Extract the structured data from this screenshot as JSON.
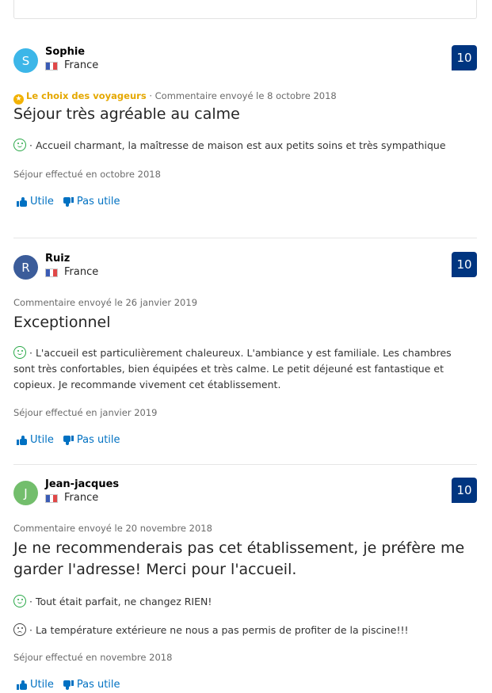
{
  "colors": {
    "score_bg": "#003580",
    "link": "#0071c2",
    "traveller_choice": "#e5a800",
    "positive": "#29a847"
  },
  "reviews": [
    {
      "avatar_letter": "S",
      "avatar_color": "#3cb6e8",
      "name": "Sophie",
      "country": "France",
      "score": "10",
      "badge": "Le choix des voyageurs",
      "badge_separator": "·",
      "posted": "Commentaire envoyé le 8 octobre 2018",
      "title": "Séjour très agréable au calme",
      "positive": "· Accueil charmant, la maîtresse de maison est aux petits soins et très sympathique",
      "stay": "Séjour effectué en octobre 2018",
      "helpful": "Utile",
      "not_helpful": "Pas utile"
    },
    {
      "avatar_letter": "R",
      "avatar_color": "#3b5c9a",
      "name": "Ruiz",
      "country": "France",
      "score": "10",
      "posted": "Commentaire envoyé le 26 janvier 2019",
      "title": "Exceptionnel",
      "positive": "· L'accueil est particulièrement chaleureux. L'ambiance y est familiale. Les chambres sont très confortables, bien équipées et très calme. Le petit déjeuné est fantastique et copieux. Je recommande vivement cet établissement.",
      "stay": "Séjour effectué en janvier 2019",
      "helpful": "Utile",
      "not_helpful": "Pas utile"
    },
    {
      "avatar_letter": "J",
      "avatar_color": "#73be6c",
      "name": "Jean-jacques",
      "country": "France",
      "score": "10",
      "posted": "Commentaire envoyé le 20 novembre 2018",
      "title": "Je ne recommenderais pas cet établissement, je préfère me garder l'adresse! Merci pour l'accueil.",
      "positive": "· Tout était parfait, ne changez RIEN!",
      "negative": "· La température extérieure ne nous a pas permis de profiter de la piscine!!!",
      "stay": "Séjour effectué en novembre 2018",
      "helpful": "Utile",
      "not_helpful": "Pas utile"
    }
  ]
}
